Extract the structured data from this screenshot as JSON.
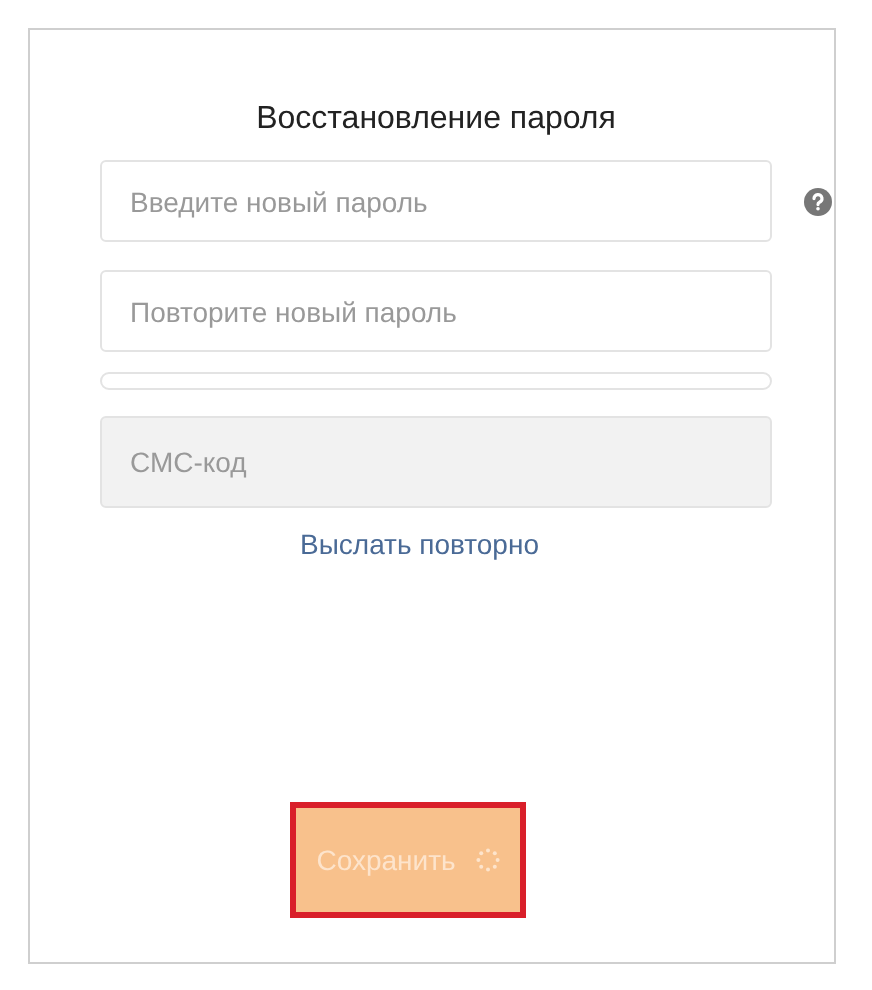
{
  "form": {
    "title": "Восстановление пароля",
    "fields": [
      {
        "kind": "password",
        "placeholder": "Введите новый пароль",
        "help": true,
        "disabled": false
      },
      {
        "kind": "password",
        "placeholder": "Повторите новый пароль",
        "help": false,
        "disabled": false
      },
      {
        "kind": "text",
        "placeholder": "СМС-код",
        "help": false,
        "disabled": true
      }
    ],
    "strength": {
      "level": 0
    },
    "resend_link": "Выслать повторно",
    "save_button": {
      "label": "Сохранить",
      "disabled": true,
      "loading": true,
      "highlighted": true
    }
  }
}
